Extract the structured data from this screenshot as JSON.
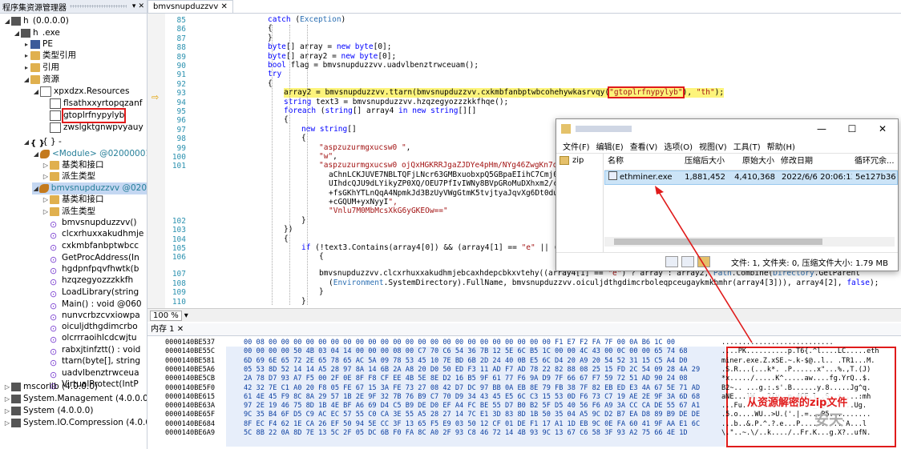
{
  "explorer": {
    "title": "程序集资源管理器",
    "nodes": [
      {
        "label": "h (0.0.0.0)",
        "indent": 0
      },
      {
        "label": "h .exe",
        "indent": 1
      },
      {
        "label": "PE",
        "indent": 2
      },
      {
        "label": "类型引用",
        "indent": 2
      },
      {
        "label": "引用",
        "indent": 2
      },
      {
        "label": "资源",
        "indent": 2
      },
      {
        "label": "xpxdzx.Resources",
        "indent": 3
      },
      {
        "label": "flsathxxyrtopqzanf",
        "indent": 4
      },
      {
        "label": "gtoplrfnypylyb",
        "indent": 4
      },
      {
        "label": "zwslgktgnwpvyauy",
        "indent": 4
      },
      {
        "label": "{ } -",
        "indent": 2
      },
      {
        "label": "<Module> @02000001",
        "indent": 3
      },
      {
        "label": "基类和接口",
        "indent": 4
      },
      {
        "label": "派生类型",
        "indent": 4
      },
      {
        "label": "bmvsnupduzzvv @020",
        "indent": 3
      },
      {
        "label": "基类和接口",
        "indent": 4
      },
      {
        "label": "派生类型",
        "indent": 4
      },
      {
        "label": "bmvsnupduzzvv()",
        "indent": 4
      },
      {
        "label": "clcxrhuxxakudhmje",
        "indent": 4
      },
      {
        "label": "cxkmbfanbptwbcc",
        "indent": 4
      },
      {
        "label": "GetProcAddress(In",
        "indent": 4
      },
      {
        "label": "hgdpnfpqvfhwtk(b",
        "indent": 4
      },
      {
        "label": "hzqzegyozzzkkfh",
        "indent": 4
      },
      {
        "label": "LoadLibrary(string",
        "indent": 4
      },
      {
        "label": "Main() : void @060",
        "indent": 4
      },
      {
        "label": "nunvcrbzcvxiowpa",
        "indent": 4
      },
      {
        "label": "oiculjdthgdimcrbo",
        "indent": 4
      },
      {
        "label": "olcrrraoihlcdcwjtu",
        "indent": 4
      },
      {
        "label": "rabxjtinfztt() : void",
        "indent": 4
      },
      {
        "label": "ttarn(byte[], string",
        "indent": 4
      },
      {
        "label": "uadvlbenztrwceua",
        "indent": 4
      },
      {
        "label": "VirtualProtect(IntP",
        "indent": 4
      },
      {
        "label": "mscorlib (4.0.0.0)",
        "indent": 0
      },
      {
        "label": "System.Management (4.0.0.0)",
        "indent": 0
      },
      {
        "label": "System (4.0.0.0)",
        "indent": 0
      },
      {
        "label": "System.IO.Compression (4.0.0.0",
        "indent": 0
      }
    ]
  },
  "editor": {
    "tab": "bmvsnupduzzvv",
    "lines": [
      {
        "n": "85",
        "code": "catch (Exception)"
      },
      {
        "n": "86",
        "code": "{"
      },
      {
        "n": "87",
        "code": "}"
      },
      {
        "n": "88",
        "code": "byte[] array = new byte[0];"
      },
      {
        "n": "89",
        "code": "byte[] array2 = new byte[0];"
      },
      {
        "n": "90",
        "code": "bool flag = bmvsnupduzzvv.uadvlbenztrwceuam();"
      },
      {
        "n": "91",
        "code": "try"
      },
      {
        "n": "92",
        "code": "{"
      },
      {
        "n": "93",
        "code": "array2 = bmvsnupduzzvv.ttarn(bmvsnupduzzvv.cxkmbfanbptwbcohehywkasrvqy(\"gtoplrfnypylyb\"), \"th\");"
      },
      {
        "n": "94",
        "code": "string text3 = bmvsnupduzzvv.hzqzegyozzzkkfhqe();"
      },
      {
        "n": "95",
        "code": "foreach (string[] array4 in new string[][]"
      },
      {
        "n": "96",
        "code": "{"
      },
      {
        "n": "97",
        "code": "new string[]"
      },
      {
        "n": "98",
        "code": "{"
      },
      {
        "n": "99",
        "code": "\"aspzuzurmgxucsw0 \","
      },
      {
        "n": "100",
        "code": "\"w\","
      },
      {
        "n": "101",
        "code": "\"aspzuzurmgxucsw0 ojQxHGKRRJgaZJDYe4pHm/NYg46ZwgKn7q"
      },
      {
        "n": "",
        "code": "aChnLCKJUVE7NBLTQFjLNcr63GMBxuobxpQ5GBpaEIihC7Cmj0"
      },
      {
        "n": "",
        "code": "UIhdcQJU9dLYikyZP0XQ/OEU7PfIvIWNy8BVpGRoMuDXhxm2/c"
      },
      {
        "n": "",
        "code": "+fsGKhYTLnQqA4NpmkJd3BzUyVWgGtmK5tvjtyaJqvXg6Dt0du"
      },
      {
        "n": "",
        "code": "+cGQUM+yxNyyI\","
      },
      {
        "n": "",
        "code": "\"Vnlu7M0MbMcsXkG6yGKEOw==\""
      },
      {
        "n": "102",
        "code": "}"
      },
      {
        "n": "103",
        "code": "})"
      },
      {
        "n": "104",
        "code": "{"
      },
      {
        "n": "105",
        "code": "if (!text3.Contains(array4[0]) && (array4[1] == \"e\" || ("
      },
      {
        "n": "106",
        "code": "{"
      },
      {
        "n": "107",
        "code": "bmvsnupduzzvv.clcxrhuxxakudhmjebcaxhdepcbkxvtehy((array4[1] == \"e\") ? array : array2, Path.Combine(Directory.GetParent"
      },
      {
        "n": "108",
        "code": "(Environment.SystemDirectory).FullName, bmvsnupduzzvv.oiculjdthgdimcrboleqpceugaykmkhmhr(array4[3])), array4[2], false);"
      },
      {
        "n": "109",
        "code": "}"
      },
      {
        "n": "110",
        "code": "}"
      }
    ],
    "zoom": "100 %"
  },
  "hex": {
    "tab": "内存 1",
    "rows": [
      {
        "addr": "0000140BE537",
        "bytes": "00 08 00 00 00 00 00 00 00 00 00 00 00 00 00 00 00 00 00 00 00 00 00 00 00 F1 E7 F2 FA 7F 00 0A B6 1C 00",
        "ascii": "..........................."
      },
      {
        "addr": "0000140BE55C",
        "bytes": "00 00 00 00 50 4B 03 04 14 00 00 00 08 00 C7 70 C6 54 36 7B 12 5E 6C B5 1C 00 00 4C 43 00 0C 00 00 65 74 68",
        "ascii": "....PK..........p.T6{.^l....LC.....eth"
      },
      {
        "addr": "0000140BE581",
        "bytes": "6D 69 6E 65 72 2E 65 78 65 AC 5A 09 78 53 45 10 7E BD 6B 2D 24 40 0B E5 6C D4 20 A9 20 54 52 31 15 C5 A4 D0",
        "ascii": "miner.exe.Z.xSE.~.k-$@..l.. .TR1...M."
      },
      {
        "addr": "0000140BE5A6",
        "bytes": "05 53 8D 52 14 14 A5 28 97 8A 14 6B 2A A8 20 D0 50 ED F3 11 AD F7 AD 78 22 82 88 08 25 15 FD 2C 54 09 28 4A 29",
        "ascii": ".S.R...(...k*. .P......x\"...%.,T.(J)"
      },
      {
        "addr": "0000140BE5CB",
        "bytes": "2A 78 D7 93 A7 F5 00 2F 0E 8F F8 CF EE 4B 5E 8E D2 16 B5 9F 61 77 F6 9A D9 7F 66 67 F7 59 72 51 AD 90 24 08",
        "ascii": "*x...../.....K^.....aw....fg.YrQ..$."
      },
      {
        "addr": "0000140BE5F0",
        "bytes": "42 32 7E C1 A0 20 F8 05 FE 67 15 3A FE 73 27 08 42 D7 DC 97 BB 0A EB 8E 79 FB 38 7F 82 EB ED E3 4A 67 5E 71 AD",
        "ascii": "B2~.. ...g.:.s'.B......y.8.....Jg^q."
      },
      {
        "addr": "0000140BE615",
        "bytes": "61 4E 45 F9 8C 8A 29 57 1B 2E 9F 32 7B 76 B9 C7 70 D9 34 43 45 E5 6C C3 15 53 0D F6 73 C7 19 AE 2E 9F 3A 6D 68",
        "ascii": "aNE...)W...2{v..p.4CE.l..S..s....:mh"
      },
      {
        "addr": "0000140BE63A",
        "bytes": "97 2E 19 46 75 8D 1B 4E BF A6 69 D4 C5 B9 DE D0 EF A4 FC BE 55 D7 B0 B2 5F D5 40 56 F6 A9 3A CC CA DE 55 67 A1",
        "ascii": "...Fu..N..i.......U..._.@V..:...Ug."
      },
      {
        "addr": "0000140BE65F",
        "bytes": "9C 35 B4 6F D5 C9 AC EC 57 55 C0 CA 3E 55 A5 28 27 14 7C E1 3D 83 8D 1B 50 35 04 A5 9C D2 B7 EA D8 89 B9 DE DE",
        "ascii": ".5.o....WU..>U.('.|.=...P5.........."
      },
      {
        "addr": "0000140BE684",
        "bytes": "8F EC F4 62 1E CA 26 EF 50 94 5E CC 3F 13 65 F5 E9 03 50 12 CF 01 DE F1 17 A1 1D EB 9C 0E FA 60 41 9F AA E1 6C",
        "ascii": "...b..&.P.^.?.e...P..........`A...l"
      },
      {
        "addr": "0000140BE6A9",
        "bytes": "5C 8B 22 0A 8D 7E 13 5C 2F 05 DC 6B F0 FA 8C A0 2F 93 C8 46 72 14 4B 93 9C 13 67 C6 58 3F 93 A2 75 66 4E 1D",
        "ascii": "\\.\"..~.\\/..k..../..Fr.K...g.X?..ufN."
      }
    ],
    "annotation": "从资源解密的zip文件",
    "watermark": "安天"
  },
  "zipwin": {
    "menu": [
      "文件(F)",
      "编辑(E)",
      "查看(V)",
      "选项(O)",
      "视图(V)",
      "工具(T)",
      "帮助(H)"
    ],
    "sidebar_item": "zip",
    "columns": [
      "名称",
      "压缩后大小",
      "原始大小",
      "修改日期",
      "循环冗余..."
    ],
    "row": [
      "ethminer.exe",
      "1,881,452",
      "4,410,368",
      "2022/6/6 20:06:13",
      "5e127b36"
    ],
    "status": "文件: 1, 文件夹: 0, 压缩文件大小: 1.79 MB",
    "win_buttons": [
      "—",
      "☐",
      "✕"
    ]
  },
  "colors": {
    "annotation": "#e01b1b",
    "highlight": "#fdf47b",
    "selection": "#c4d7f2"
  }
}
